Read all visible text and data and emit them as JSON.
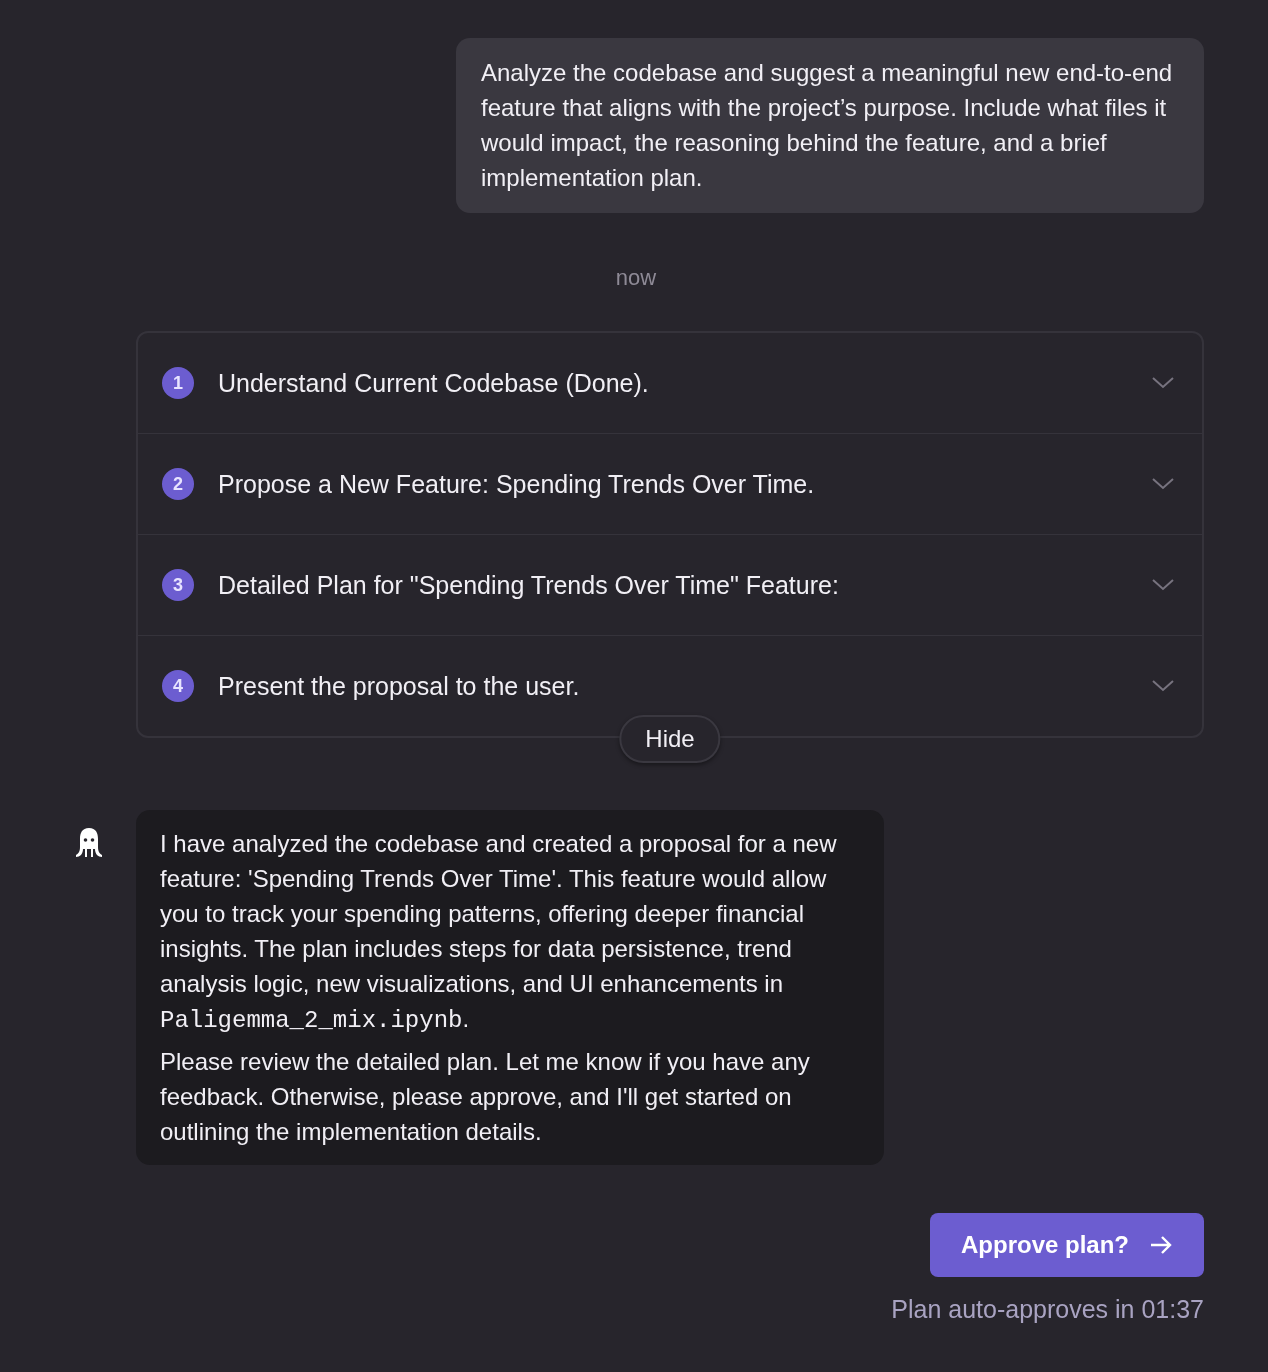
{
  "user_message": {
    "text": "Analyze the codebase and suggest a meaningful new end-to-end feature that aligns with the project’s purpose. Include what files it would impact, the reasoning behind the feature, and a brief implementation plan."
  },
  "timestamp": "now",
  "plan_steps": [
    {
      "number": "1",
      "title": "Understand Current Codebase (Done).",
      "expanded": false
    },
    {
      "number": "2",
      "title": "Propose a New Feature: Spending Trends Over Time.",
      "expanded": false
    },
    {
      "number": "3",
      "title": "Detailed Plan for \"Spending Trends Over Time\" Feature:",
      "expanded": false
    },
    {
      "number": "4",
      "title": "Present the proposal to the user.",
      "expanded": false
    }
  ],
  "hide_button": "Hide",
  "agent_message": {
    "paragraphs": [
      {
        "parts": [
          {
            "kind": "text",
            "text": "I have analyzed the codebase and created a proposal for a new feature: 'Spending Trends Over Time'. This feature would allow you to track your spending patterns, offering deeper financial insights. The plan includes steps for data persistence, trend analysis logic, new visualizations, and UI enhancements in "
          },
          {
            "kind": "code",
            "text": "Paligemma_2_mix.ipynb"
          },
          {
            "kind": "text",
            "text": "."
          }
        ]
      },
      {
        "parts": [
          {
            "kind": "text",
            "text": "Please review the detailed plan. Let me know if you have any feedback. Otherwise, please approve, and I'll get started on outlining the implementation details."
          }
        ]
      }
    ]
  },
  "approve_button": "Approve plan?",
  "auto_approve_note": "Plan auto-approves in 01:37"
}
